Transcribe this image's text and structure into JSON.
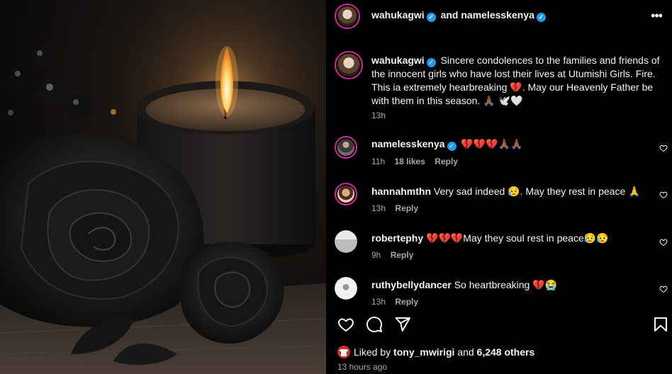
{
  "post": {
    "author": "wahukagwi",
    "and_label": "and",
    "collaborator": "namelesskenya",
    "more_glyph": "•••",
    "caption": {
      "username": "wahukagwi",
      "text": "Sincere condolences to the families and friends of the innocent girls who have lost their lives at Utumishi Girls. Fire. This ia extremely hearbreaking 💔. May our Heavenly Father be with them in this season. 🙏🏾 🕊️🤍",
      "time": "13h"
    }
  },
  "comments": [
    {
      "username": "namelesskenya",
      "verified": true,
      "text": "💔💔💔🙏🏾🙏🏾",
      "time": "11h",
      "likes": "18 likes",
      "reply": "Reply"
    },
    {
      "username": "hannahmthn",
      "verified": false,
      "text": "Very sad indeed 😥. May they rest in peace 🙏",
      "time": "13h",
      "likes": "",
      "reply": "Reply"
    },
    {
      "username": "robertephy",
      "verified": false,
      "text": "💔💔💔May they soul rest in peace😥😥",
      "time": "9h",
      "likes": "",
      "reply": "Reply"
    },
    {
      "username": "ruthybellydancer",
      "verified": false,
      "text": "So heartbreaking 💔😭",
      "time": "13h",
      "likes": "",
      "reply": "Reply"
    }
  ],
  "engagement": {
    "liked_by_prefix": "Liked by",
    "liked_by_user": "tony_mwirigi",
    "and_label": "and",
    "others": "6,248 others",
    "time_ago": "13 hours ago"
  },
  "icons": {
    "like": "heart-icon",
    "comment": "comment-icon",
    "share": "share-icon",
    "save": "bookmark-icon",
    "verified": "verified-badge-icon",
    "more": "more-options-icon"
  },
  "colors": {
    "background": "#000000",
    "text": "#f5f5f5",
    "secondary_text": "#a8a8a8",
    "verified": "#1d9bf0",
    "story_ring": "#d6249f"
  }
}
